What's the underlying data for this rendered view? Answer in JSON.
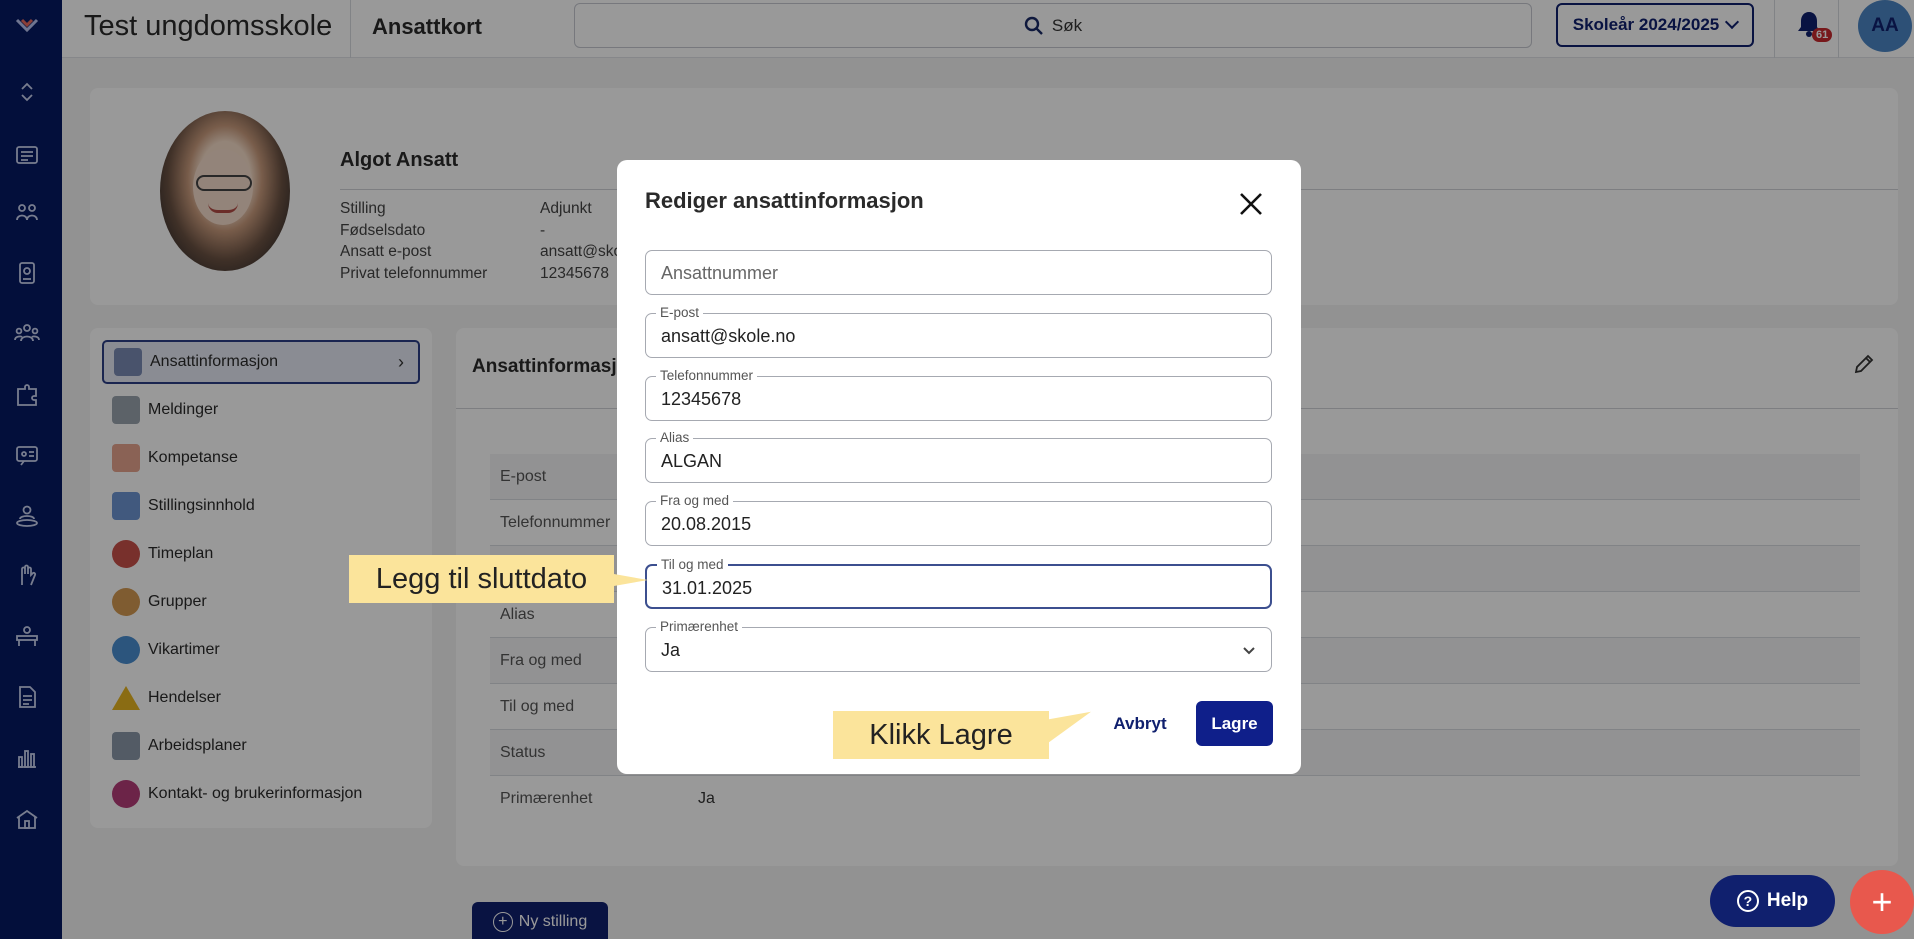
{
  "topbar": {
    "school_name": "Test ungdomsskole",
    "page_title": "Ansattkort",
    "search_label": "Søk",
    "school_year": "Skoleår 2024/2025",
    "notification_count": "61",
    "user_initials": "AA"
  },
  "profile": {
    "name": "Algot Ansatt",
    "rows": [
      {
        "key": "Stilling",
        "value": "Adjunkt"
      },
      {
        "key": "Fødselsdato",
        "value": "-"
      },
      {
        "key": "Ansatt e-post",
        "value": "ansatt@sko"
      },
      {
        "key": "Privat telefonnummer",
        "value": "12345678"
      }
    ]
  },
  "menu": {
    "items": [
      {
        "label": "Ansattinformasjon",
        "icon": "employee-info-icon",
        "color": "#7a8bb5"
      },
      {
        "label": "Meldinger",
        "icon": "envelope-icon",
        "color": "#9aa3ad"
      },
      {
        "label": "Kompetanse",
        "icon": "certificate-icon",
        "color": "#e7a48e"
      },
      {
        "label": "Stillingsinnhold",
        "icon": "document-list-icon",
        "color": "#6d95d2"
      },
      {
        "label": "Timeplan",
        "icon": "clock-calendar-icon",
        "color": "#c8504a"
      },
      {
        "label": "Grupper",
        "icon": "group-icon",
        "color": "#d49a52"
      },
      {
        "label": "Vikartimer",
        "icon": "substitute-icon",
        "color": "#4a8ed0"
      },
      {
        "label": "Hendelser",
        "icon": "warning-icon",
        "color": "#e7b421"
      },
      {
        "label": "Arbeidsplaner",
        "icon": "clipboard-icon",
        "color": "#8a98a8"
      },
      {
        "label": "Kontakt- og brukerinformasjon",
        "icon": "fingerprint-icon",
        "color": "#b43c78"
      }
    ]
  },
  "main": {
    "heading": "Ansattinformasjon",
    "rows": [
      {
        "key": "E-post",
        "value": ""
      },
      {
        "key": "Telefonnummer",
        "value": ""
      },
      {
        "key": "",
        "value": ""
      },
      {
        "key": "Alias",
        "value": ""
      },
      {
        "key": "Fra og med",
        "value": ""
      },
      {
        "key": "Til og med",
        "value": ""
      },
      {
        "key": "Status",
        "value": ""
      },
      {
        "key": "Primærenhet",
        "value": "Ja"
      }
    ],
    "new_position_label": "Ny stilling"
  },
  "modal": {
    "title": "Rediger ansattinformasjon",
    "fields": {
      "employee_number": {
        "placeholder": "Ansattnummer"
      },
      "email": {
        "label": "E-post",
        "value": "ansatt@skole.no"
      },
      "phone": {
        "label": "Telefonnummer",
        "value": "12345678"
      },
      "alias": {
        "label": "Alias",
        "value": "ALGAN"
      },
      "from_date": {
        "label": "Fra og med",
        "value": "20.08.2015"
      },
      "to_date": {
        "label": "Til og med",
        "value": "31.01.2025"
      },
      "primary_unit": {
        "label": "Primærenhet",
        "value": "Ja"
      }
    },
    "cancel_label": "Avbryt",
    "save_label": "Lagre"
  },
  "callouts": {
    "end_date": "Legg til sluttdato",
    "click_save": "Klikk Lagre"
  },
  "help_label": "Help",
  "fab_label": "+"
}
